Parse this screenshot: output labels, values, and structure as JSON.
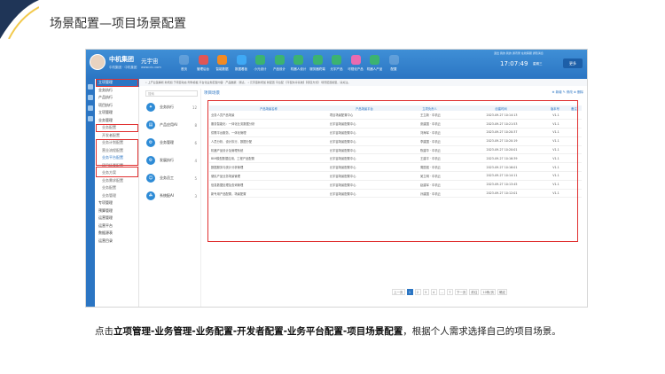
{
  "page": {
    "title": "场景配置—项目场景配置",
    "accent": "#2b75c3",
    "highlight": "#e03030",
    "caption_parts": [
      {
        "text": "点击",
        "bold": false
      },
      {
        "text": "立项管理-业务管理-业务配置-开发者配置-业务平台配置-项目场景配置",
        "bold": true
      },
      {
        "text": "，根据个人需求选择自己的项目场景。",
        "bold": false
      }
    ]
  },
  "app": {
    "company": "中机集团",
    "company_sub": "中机集团 · 中机集团",
    "universe": "元宇宙",
    "universe_sub": "www.cic.com",
    "top_links": "退出  我的  我的  通讯录  在线客服  通知消息",
    "nav": [
      {
        "label": "首页",
        "icon": "home-icon",
        "color": "#ffffff33"
      },
      {
        "label": "管理后台",
        "icon": "briefcase-icon",
        "color": "#e05656"
      },
      {
        "label": "智能数据",
        "icon": "chart-icon",
        "color": "#f08a24"
      },
      {
        "label": "数据看板",
        "icon": "board-icon",
        "color": "#3fa9f5"
      },
      {
        "label": "小元设计",
        "icon": "design-icon",
        "color": "#3cb371"
      },
      {
        "label": "产品设计",
        "icon": "product-icon",
        "color": "#3cb371"
      },
      {
        "label": "机器人设计",
        "icon": "robot-icon",
        "color": "#3cb371"
      },
      {
        "label": "服务器终端",
        "icon": "server-icon",
        "color": "#3cb371"
      },
      {
        "label": "元宇产品",
        "icon": "cube-icon",
        "color": "#3cb371"
      },
      {
        "label": "可视化产品",
        "icon": "eye-icon",
        "color": "#e86bb0"
      },
      {
        "label": "机器人产品",
        "icon": "bot-icon",
        "color": "#3cb371"
      },
      {
        "label": "配置",
        "icon": "plus-icon",
        "color": "#ffffff33"
      }
    ],
    "clock": "17:07:49",
    "clock_sub": "星期三",
    "more": "更多"
  },
  "sidebar": {
    "items": [
      {
        "label": "立项管理",
        "type": "active"
      },
      {
        "label": "业务执行",
        "type": "item"
      },
      {
        "label": "产品执行",
        "type": "item"
      },
      {
        "label": "项目执行",
        "type": "item"
      },
      {
        "label": "立项管理",
        "type": "item"
      },
      {
        "label": "业务管理",
        "type": "item"
      },
      {
        "label": "业务配置",
        "type": "sub"
      },
      {
        "label": "开发者配置",
        "type": "sub"
      },
      {
        "label": "业务计划配置",
        "type": "sub"
      },
      {
        "label": "营业流程配置",
        "type": "sub"
      },
      {
        "label": "业务平台配置",
        "type": "sub-sel"
      },
      {
        "label": "项目场景配置",
        "type": "sub"
      },
      {
        "label": "业务方案",
        "type": "sub"
      },
      {
        "label": "业务需求配置",
        "type": "sub"
      },
      {
        "label": "业务配置",
        "type": "sub"
      },
      {
        "label": "业务管理",
        "type": "sub"
      },
      {
        "label": "专项管理",
        "type": "item"
      },
      {
        "label": "预算管理",
        "type": "item"
      },
      {
        "label": "运营管理",
        "type": "item"
      },
      {
        "label": "运营平台",
        "type": "item"
      },
      {
        "label": "数据源表",
        "type": "item"
      },
      {
        "label": "运营目录",
        "type": "item"
      }
    ]
  },
  "notice": "• 上产业链解析 新增加 于项目动态 附件模板 平台化业务配置内容 · 产品数据 · 测试。          • 元宇宙新增加 新配置 平台配 【平配共享系统】【项目方式】  场景配置模型，请关注。",
  "categories": {
    "search_placeholder": "搜索",
    "items": [
      {
        "label": "业务执行",
        "count": "12",
        "icon": "fingerprint-icon",
        "sym": "✦"
      },
      {
        "label": "产品应用AI",
        "count": "8",
        "icon": "doc-icon",
        "sym": "▤"
      },
      {
        "label": "业务管理",
        "count": "6",
        "icon": "gear-icon",
        "sym": "⚙"
      },
      {
        "label": "发展执行",
        "count": "4",
        "icon": "gear-icon",
        "sym": "⚙"
      },
      {
        "label": "业务员工",
        "count": "5",
        "icon": "person-icon",
        "sym": "☺"
      },
      {
        "label": "系统配AI",
        "count": "3",
        "icon": "network-icon",
        "sym": "☘"
      }
    ]
  },
  "content": {
    "title": "项目场景",
    "toolbar": "⊕ 新增   ✎ 修改   ⊗ 删除",
    "columns": [
      "产品场景名称",
      "产品场景平台",
      "立项负责人",
      "创建时间",
      "版本号",
      "备注"
    ],
    "rows": [
      [
        "业务人员产品场景",
        "项目场景配置中心",
        "王立新 · 中机云",
        "2023-09-27 10:14:13",
        "V1.1",
        ""
      ],
      [
        "服务智能化：一体化业务数据分析",
        "元宇宙场景配置中心",
        "张建国 · 中机云",
        "2023-09-27 10:21:53",
        "V1.1",
        ""
      ],
      [
        "供需平台服务，一体化管理",
        "元宇宙场景配置中心",
        "刘海军 · 中机云",
        "2023-09-27 10:20:37",
        "V1.1",
        ""
      ],
      [
        "人员分析、设计执行、数据分配",
        "元宇宙场景配置中心",
        "李建国 · 中机云",
        "2023-09-27 10:20:19",
        "V1.1",
        ""
      ],
      [
        "机器产品设计及管理系统",
        "元宇宙场景配置中心",
        "陈建华 · 中机云",
        "2023-09-27 10:20:01",
        "V1.1",
        ""
      ],
      [
        "BIM模型数据应用，工程产品配置",
        "元宇宙场景配置中心",
        "王建平 · 中机云",
        "2023-09-27 10:16:39",
        "V1.1",
        ""
      ],
      [
        "数据服务与统计分析管理",
        "元宇宙场景配置中心",
        "周国强 · 中机云",
        "2023-09-27 10:16:01",
        "V1.1",
        ""
      ],
      [
        "便民产品业务场景管理",
        "元宇宙场景配置中心",
        "吴立明 · 中机云",
        "2023-09-27 10:14:11",
        "V1.1",
        ""
      ],
      [
        "信息数据处理及查询管理",
        "元宇宙场景配置中心",
        "赵建军 · 中机云",
        "2023-09-27 10:13:45",
        "V1.1",
        ""
      ],
      [
        "新专用产品配置，场景配置",
        "元宇宙场景配置中心",
        "孙建国 · 中机云",
        "2023-09-27 10:12:01",
        "V1.1",
        ""
      ]
    ],
    "pager": {
      "prev": "上一页",
      "next": "下一页",
      "pages": [
        "1",
        "2",
        "3",
        "4",
        "...",
        "7"
      ],
      "current": "1",
      "goto": "前往",
      "page_size": "10条/页",
      "jump": "确定"
    }
  }
}
